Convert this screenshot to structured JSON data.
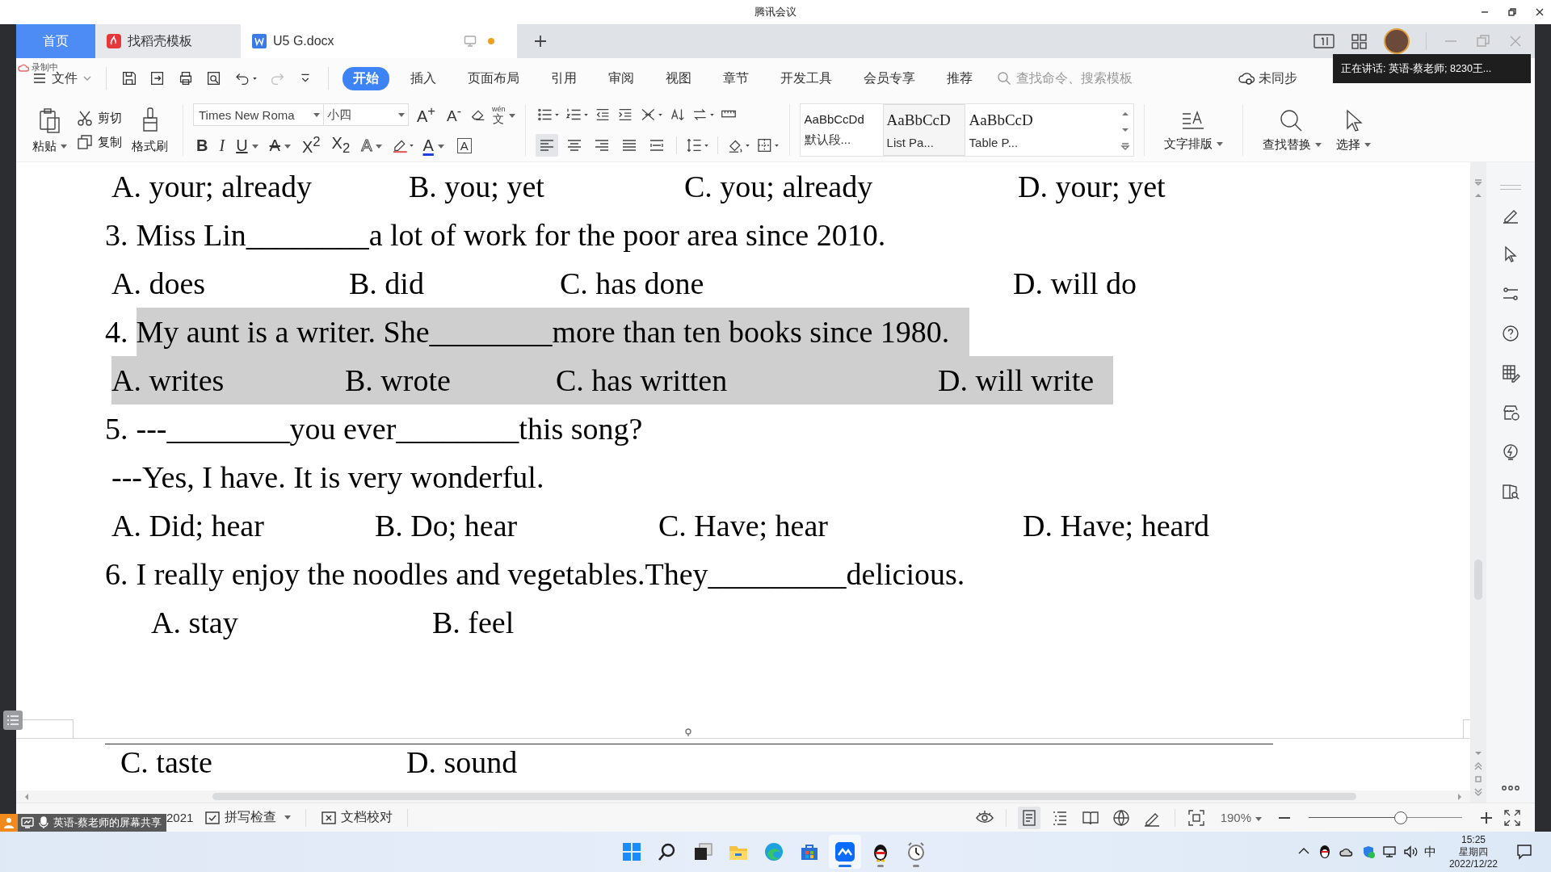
{
  "title_bar": {
    "title": "腾讯会议"
  },
  "tabs": [
    {
      "kind": "home",
      "label": "首页",
      "selected": false
    },
    {
      "kind": "template",
      "label": "找稻壳模板",
      "selected": false
    },
    {
      "kind": "document",
      "label": "U5 G.docx",
      "selected": true,
      "modified": true
    }
  ],
  "recording": {
    "label": "录制中"
  },
  "menu": {
    "file": "文件",
    "items": [
      {
        "label": "开始",
        "selected": true
      },
      {
        "label": "插入",
        "selected": false
      },
      {
        "label": "页面布局",
        "selected": false
      },
      {
        "label": "引用",
        "selected": false
      },
      {
        "label": "审阅",
        "selected": false
      },
      {
        "label": "视图",
        "selected": false
      },
      {
        "label": "章节",
        "selected": false
      },
      {
        "label": "开发工具",
        "selected": false
      },
      {
        "label": "会员专享",
        "selected": false
      },
      {
        "label": "推荐",
        "selected": false
      }
    ],
    "search": {
      "placeholder": "查找命令、搜索模板"
    },
    "sync": "未同步"
  },
  "speaking_tooltip": "正在讲话: 英语-蔡老师; 8230王...",
  "ribbon": {
    "paste": "粘贴",
    "cut": "剪切",
    "copy": "复制",
    "format_painter": "格式刷",
    "font": "Times New Roma",
    "size": "小四",
    "size_buttons": [
      {
        "kind": "grow",
        "label": "A$^{+}$"
      },
      {
        "kind": "shrink",
        "label": "A$^{-}$"
      }
    ],
    "pinyin": {
      "ruby": "wén",
      "char": "文"
    },
    "format_buttons": [
      {
        "kind": "bold",
        "label": "B"
      },
      {
        "kind": "italic",
        "label": "I"
      },
      {
        "kind": "underline",
        "label": "U"
      },
      {
        "kind": "strike",
        "label": "A"
      },
      {
        "kind": "sup",
        "label": "X$^{2}$"
      },
      {
        "kind": "sub",
        "label": "X$_{2}$"
      },
      {
        "kind": "effect",
        "label": "A"
      },
      {
        "kind": "color",
        "label": "A"
      },
      {
        "kind": "boxed",
        "label": "A"
      }
    ],
    "alignment": [
      {
        "kind": "left",
        "selected": true
      },
      {
        "kind": "center",
        "selected": false
      },
      {
        "kind": "right",
        "selected": false
      },
      {
        "kind": "justify",
        "selected": false
      },
      {
        "kind": "distribute",
        "selected": false
      }
    ],
    "styles": [
      {
        "kind": "plain",
        "sample": "AaBbCcDd",
        "name": "默认段...",
        "selected": false
      },
      {
        "kind": "serif",
        "sample": "AaBbCcD",
        "name": "List Pa...",
        "selected": true
      },
      {
        "kind": "serif",
        "sample": "AaBbCcD",
        "name": "Table P...",
        "selected": false
      }
    ],
    "text_layout": "文字排版",
    "find_replace": "查找替换",
    "select": "选择"
  },
  "document": {
    "lines": [
      {
        "kind": "options",
        "highlighted": false,
        "options": [
          "A. your; already",
          "B. you; yet",
          "C. you; already",
          "D. your; yet"
        ]
      },
      {
        "kind": "question",
        "highlighted": false,
        "number": "3.",
        "text": "Miss Lin________a lot of work for the poor area since 2010."
      },
      {
        "kind": "options",
        "highlighted": false,
        "options": [
          "A. does",
          "B. did",
          "C. has done",
          "D. will do"
        ]
      },
      {
        "kind": "question",
        "highlighted": true,
        "number": "4.",
        "text": "My aunt is a writer. She________more than ten books since 1980."
      },
      {
        "kind": "options",
        "highlighted": true,
        "options": [
          "A. writes",
          "B. wrote",
          "C. has written",
          "D. will write"
        ]
      },
      {
        "kind": "question",
        "highlighted": false,
        "number": "5.",
        "text": "---________you ever________this song?"
      },
      {
        "kind": "line",
        "text": "---Yes, I have. It is very wonderful."
      },
      {
        "kind": "options",
        "highlighted": false,
        "options": [
          "A. Did; hear",
          "B. Do; hear",
          "C. Have; hear",
          "D. Have; heard"
        ]
      },
      {
        "kind": "question",
        "highlighted": false,
        "number": "6.",
        "text": "I really enjoy the noodles and vegetables.They_________delicious."
      },
      {
        "kind": "options",
        "highlighted": false,
        "options": [
          "A. stay",
          "B. feel"
        ]
      }
    ],
    "next_page": {
      "options": [
        "C. taste",
        "D. sound"
      ]
    }
  },
  "status_bar": {
    "word_count": "2021",
    "spell_check": "拼写检查",
    "proofread": "文档校对",
    "views": [
      {
        "kind": "page",
        "selected": true
      },
      {
        "kind": "outline",
        "selected": false
      },
      {
        "kind": "reading",
        "selected": false
      },
      {
        "kind": "web",
        "selected": false
      },
      {
        "kind": "write",
        "selected": false
      }
    ],
    "zoom": "190%",
    "zoom_slider": {
      "level": 0.6
    }
  },
  "screen_share": {
    "label": "英语-蔡老师的屏幕共享"
  },
  "taskbar": {
    "apps": [
      {
        "kind": "start",
        "selected": false,
        "running": false
      },
      {
        "kind": "search",
        "selected": false,
        "running": false
      },
      {
        "kind": "taskview",
        "selected": false,
        "running": false
      },
      {
        "kind": "explorer",
        "selected": false,
        "running": false
      },
      {
        "kind": "edge",
        "selected": false,
        "running": false
      },
      {
        "kind": "store",
        "selected": false,
        "running": false
      },
      {
        "kind": "meeting",
        "selected": true,
        "running": true
      },
      {
        "kind": "qq",
        "selected": false,
        "running": true
      },
      {
        "kind": "clock",
        "selected": false,
        "running": true
      }
    ],
    "tray": {
      "ime": "中",
      "time": "15:25",
      "weekday": "星期四",
      "date": "2022/12/22"
    }
  }
}
